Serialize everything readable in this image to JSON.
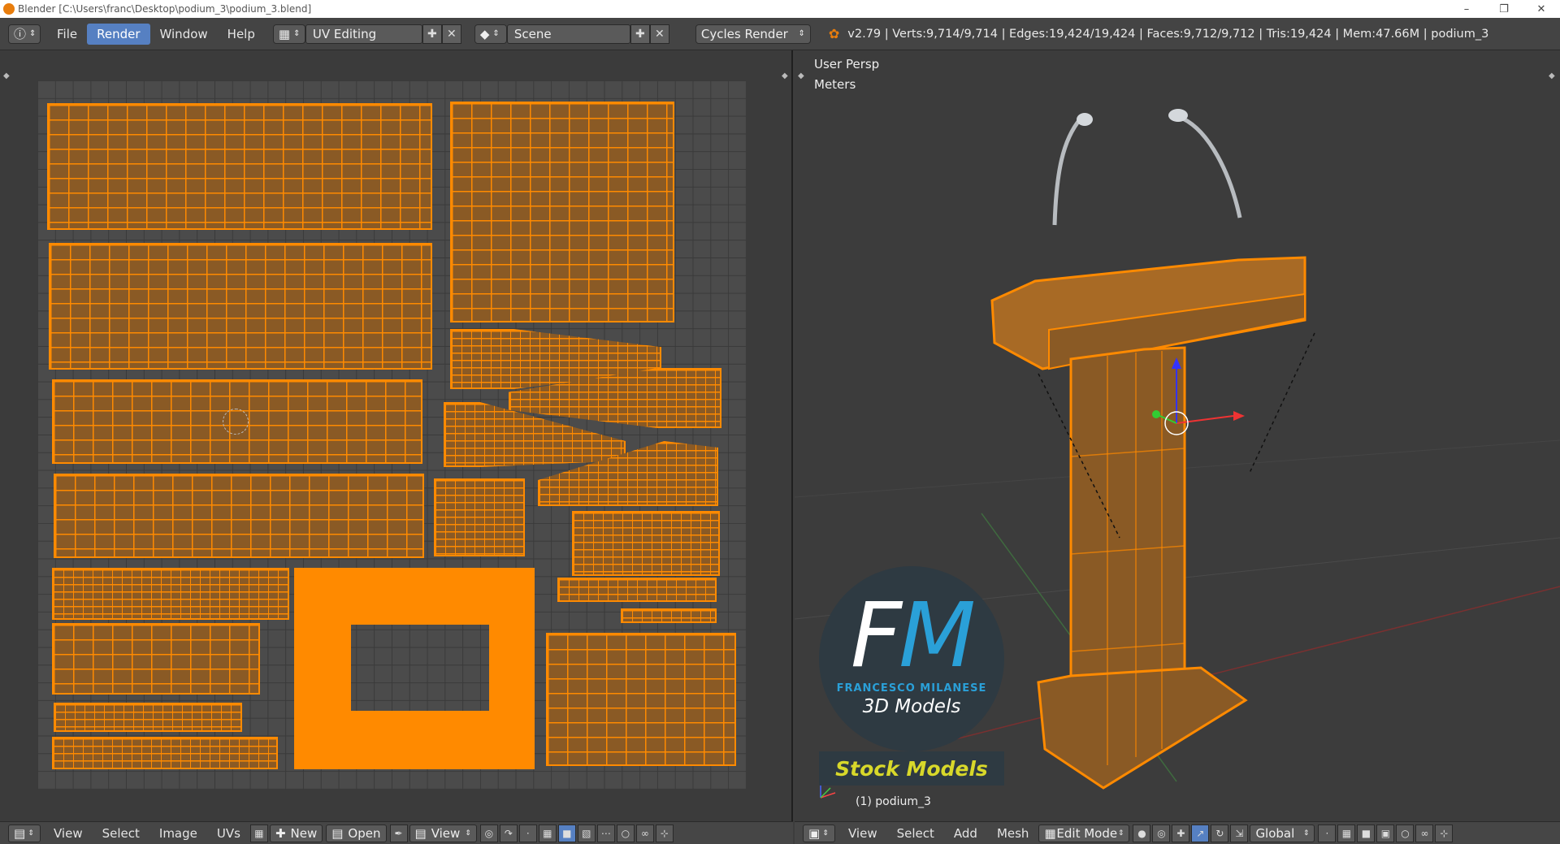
{
  "window": {
    "title": "Blender [C:\\Users\\franc\\Desktop\\podium_3\\podium_3.blend]"
  },
  "menu": {
    "file": "File",
    "render": "Render",
    "window": "Window",
    "help": "Help"
  },
  "layout": {
    "name": "UV Editing"
  },
  "scene": {
    "name": "Scene"
  },
  "engine": {
    "name": "Cycles Render"
  },
  "stats": "v2.79 | Verts:9,714/9,714 | Edges:19,424/19,424 | Faces:9,712/9,712 | Tris:19,424 | Mem:47.66M | podium_3",
  "viewport": {
    "view_label": "User Persp",
    "units_label": "Meters",
    "object_label": "(1) podium_3"
  },
  "logo": {
    "fm_f": "F",
    "fm_m": "M",
    "name": "FRANCESCO MILANESE",
    "sub": "3D Models",
    "stock": "Stock Models"
  },
  "uv_footer": {
    "view": "View",
    "select": "Select",
    "image": "Image",
    "uvs": "UVs",
    "new": "New",
    "open": "Open",
    "view2": "View"
  },
  "vp_footer": {
    "view": "View",
    "select": "Select",
    "add": "Add",
    "mesh": "Mesh",
    "mode": "Edit Mode",
    "orientation": "Global"
  },
  "colors": {
    "accent": "#5680c2",
    "uv_orange": "#ff8a00",
    "blender_orange": "#e87d0d",
    "logo_blue": "#2aa0d8",
    "stock_yellow": "#d8d82a"
  }
}
